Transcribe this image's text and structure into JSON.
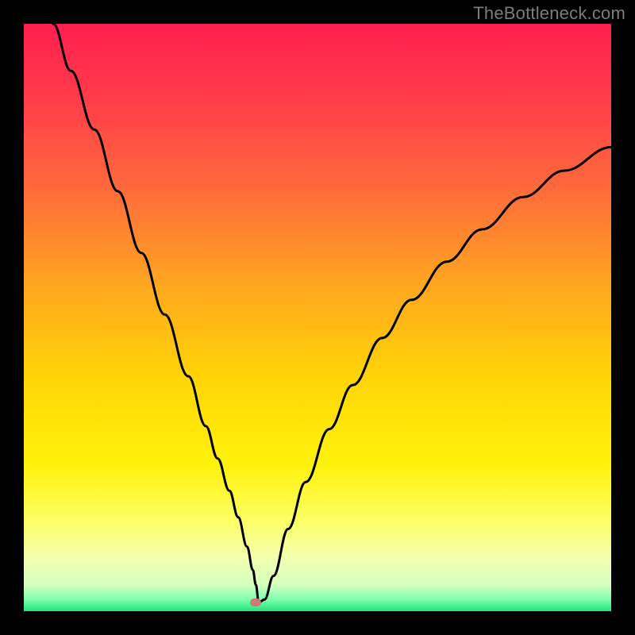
{
  "watermark": "TheBottleneck.com",
  "gradient": {
    "stops": [
      {
        "pos": 0.0,
        "color": "#ff1f4f"
      },
      {
        "pos": 0.12,
        "color": "#ff3a4a"
      },
      {
        "pos": 0.28,
        "color": "#ff6a3c"
      },
      {
        "pos": 0.45,
        "color": "#ffa81f"
      },
      {
        "pos": 0.6,
        "color": "#ffd407"
      },
      {
        "pos": 0.75,
        "color": "#fff20a"
      },
      {
        "pos": 0.85,
        "color": "#fcff6a"
      },
      {
        "pos": 0.91,
        "color": "#f3ffb0"
      },
      {
        "pos": 0.955,
        "color": "#d6ffbf"
      },
      {
        "pos": 0.98,
        "color": "#7dffad"
      },
      {
        "pos": 1.0,
        "color": "#23e27a"
      }
    ]
  },
  "marker": {
    "x_frac": 0.395,
    "y_frac": 0.985,
    "color": "#cb7a77"
  },
  "chart_data": {
    "type": "line",
    "title": "",
    "xlabel": "",
    "ylabel": "",
    "xlim": [
      0,
      100
    ],
    "ylim": [
      0,
      100
    ],
    "legend": false,
    "grid": false,
    "series": [
      {
        "name": "bottleneck-curve",
        "x": [
          5,
          8,
          12,
          16,
          20,
          24,
          28,
          31,
          33,
          35,
          36.5,
          38,
          39,
          39.5,
          40,
          41,
          42.5,
          45,
          48,
          52,
          56,
          61,
          66,
          72,
          78,
          85,
          92,
          100
        ],
        "y": [
          100,
          92,
          82,
          71.5,
          61,
          50.5,
          40,
          31.5,
          26,
          20.5,
          16,
          11,
          7,
          4.5,
          1.5,
          2,
          6,
          14,
          22,
          31,
          38.5,
          46.5,
          53,
          59.5,
          65,
          70.5,
          75,
          79
        ]
      }
    ],
    "annotations": [
      {
        "text": "TheBottleneck.com",
        "position": "top-right"
      }
    ],
    "optimum_point": {
      "x": 39.5,
      "y": 1.5
    }
  }
}
